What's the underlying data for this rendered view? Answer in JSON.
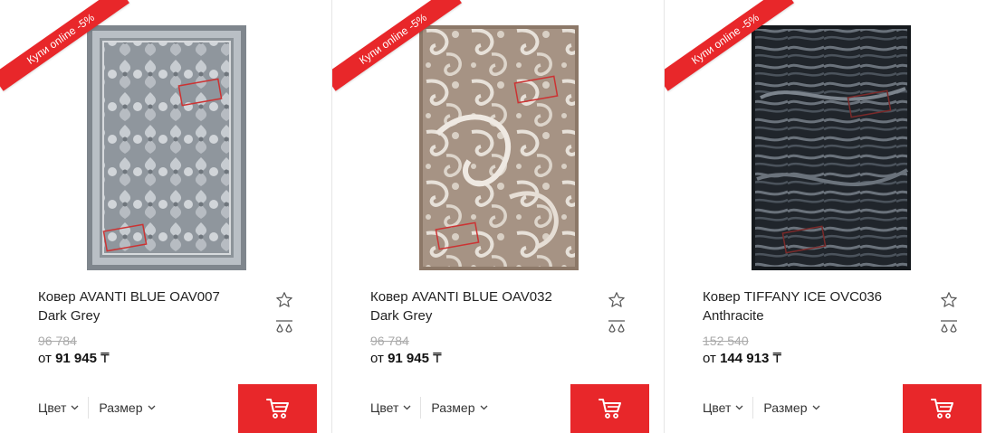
{
  "products": [
    {
      "badge": "Купи online -5%",
      "title": "Ковер AVANTI BLUE OAV007 Dark Grey",
      "old_price": "96 784",
      "price_prefix": "от",
      "price": "91 945",
      "currency": "₸",
      "color_label": "Цвет",
      "size_label": "Размер",
      "image": "rug-grey-damask"
    },
    {
      "badge": "Купи online -5%",
      "title": "Ковер AVANTI BLUE OAV032 Dark Grey",
      "old_price": "96 784",
      "price_prefix": "от",
      "price": "91 945",
      "currency": "₸",
      "color_label": "Цвет",
      "size_label": "Размер",
      "image": "rug-beige-paisley"
    },
    {
      "badge": "Купи online -5%",
      "title": "Ковер TIFFANY ICE OVC036 Anthracite",
      "old_price": "152 540",
      "price_prefix": "от",
      "price": "144 913",
      "currency": "₸",
      "color_label": "Цвет",
      "size_label": "Размер",
      "image": "rug-anthracite-zebra"
    }
  ],
  "icons": {
    "favorite": "star-icon",
    "compare": "compare-scales-icon",
    "cart": "cart-icon",
    "dropdown": "chevron-down-icon"
  },
  "colors": {
    "accent": "#e8272a",
    "old_price": "#aaaaaa",
    "text": "#222222"
  }
}
